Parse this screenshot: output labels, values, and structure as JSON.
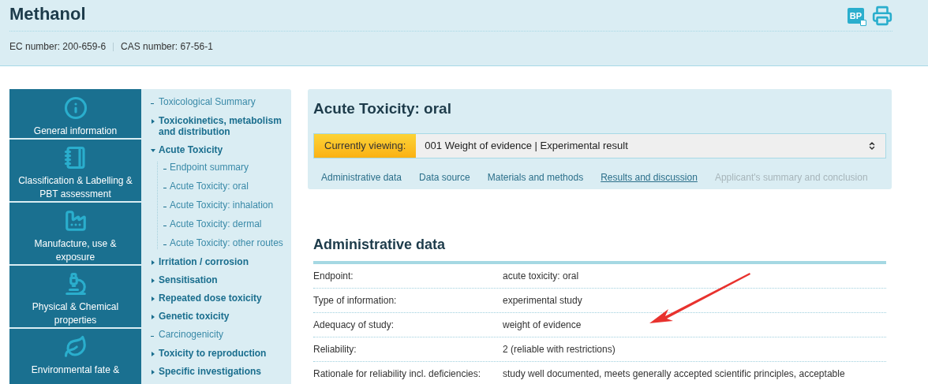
{
  "header": {
    "title": "Methanol",
    "bp_badge": "BP",
    "identifiers": [
      {
        "label": "EC number: 200-659-6"
      },
      {
        "label": "CAS number: 67-56-1"
      }
    ]
  },
  "categories": [
    {
      "kind": "info",
      "label": "General information"
    },
    {
      "kind": "book",
      "label": "Classification & Labelling & PBT assessment"
    },
    {
      "kind": "factory",
      "label": "Manufacture, use & exposure"
    },
    {
      "kind": "microscope",
      "label": "Physical & Chemical properties"
    },
    {
      "kind": "leaf",
      "label": "Environmental fate &"
    }
  ],
  "sections": [
    {
      "label": "Toxicological Summary",
      "kind": "leaf"
    },
    {
      "label": "Toxicokinetics, metabolism and distribution",
      "kind": "branch",
      "expanded": false
    },
    {
      "label": "Acute Toxicity",
      "kind": "branch",
      "expanded": true,
      "children": [
        {
          "label": "Endpoint summary"
        },
        {
          "label": "Acute Toxicity: oral"
        },
        {
          "label": "Acute Toxicity: inhalation"
        },
        {
          "label": "Acute Toxicity: dermal"
        },
        {
          "label": "Acute Toxicity: other routes"
        }
      ]
    },
    {
      "label": "Irritation / corrosion",
      "kind": "branch",
      "expanded": false
    },
    {
      "label": "Sensitisation",
      "kind": "branch",
      "expanded": false
    },
    {
      "label": "Repeated dose toxicity",
      "kind": "branch",
      "expanded": false
    },
    {
      "label": "Genetic toxicity",
      "kind": "branch",
      "expanded": false
    },
    {
      "label": "Carcinogenicity",
      "kind": "leaf"
    },
    {
      "label": "Toxicity to reproduction",
      "kind": "branch",
      "expanded": false
    },
    {
      "label": "Specific investigations",
      "kind": "branch",
      "expanded": false
    }
  ],
  "record": {
    "title": "Acute Toxicity: oral",
    "viewing_label": "Currently viewing:",
    "viewing_value": "001 Weight of evidence | Experimental result",
    "tabs": [
      {
        "label": "Administrative data",
        "selected": false,
        "disabled": false
      },
      {
        "label": "Data source",
        "selected": false,
        "disabled": false
      },
      {
        "label": "Materials and methods",
        "selected": false,
        "disabled": false
      },
      {
        "label": "Results and discussion",
        "selected": true,
        "disabled": false
      },
      {
        "label": "Applicant's summary and conclusion",
        "selected": false,
        "disabled": true
      }
    ]
  },
  "admin": {
    "heading": "Administrative data",
    "rows": [
      {
        "label": "Endpoint:",
        "value": "acute toxicity: oral"
      },
      {
        "label": "Type of information:",
        "value": "experimental study"
      },
      {
        "label": "Adequacy of study:",
        "value": "weight of evidence"
      },
      {
        "label": "Reliability:",
        "value": "2 (reliable with restrictions)"
      },
      {
        "label": "Rationale for reliability incl. deficiencies:",
        "value": "study well documented, meets generally accepted scientific principles, acceptable"
      }
    ]
  }
}
